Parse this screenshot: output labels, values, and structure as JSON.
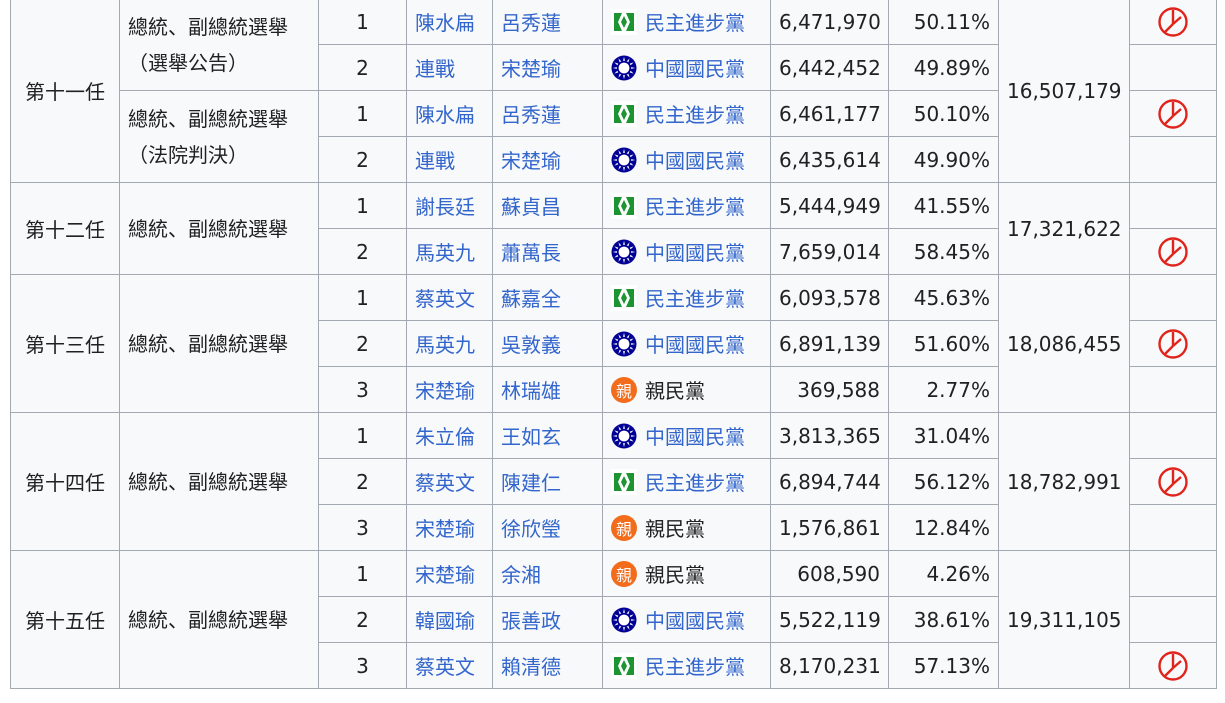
{
  "parties": {
    "dpp": {
      "name": "民主進步黨",
      "icon": "dpp-flag-icon",
      "color": "#1b9431"
    },
    "kmt": {
      "name": "中國國民黨",
      "icon": "kmt-sun-icon",
      "color": "#000095"
    },
    "pfp": {
      "name": "親民黨",
      "icon": "pfp-logo-icon",
      "color": "#f26c1b",
      "glyph": "親"
    }
  },
  "winner_mark": {
    "icon": "elected-stamp-icon",
    "color": "#e0241b"
  },
  "elections": [
    {
      "term": "第十一任",
      "total": "16,507,179",
      "subelections": [
        {
          "type": "總統、副總統選舉",
          "subtype": "（選舉公告）",
          "rows": [
            {
              "no": "1",
              "president": "陳水扁",
              "vice": "呂秀蓮",
              "party": "dpp",
              "votes": "6,471,970",
              "pct": "50.11%",
              "winner": true
            },
            {
              "no": "2",
              "president": "連戰",
              "vice": "宋楚瑜",
              "party": "kmt",
              "votes": "6,442,452",
              "pct": "49.89%",
              "winner": false
            }
          ]
        },
        {
          "type": "總統、副總統選舉",
          "subtype": "（法院判決）",
          "rows": [
            {
              "no": "1",
              "president": "陳水扁",
              "vice": "呂秀蓮",
              "party": "dpp",
              "votes": "6,461,177",
              "pct": "50.10%",
              "winner": true
            },
            {
              "no": "2",
              "president": "連戰",
              "vice": "宋楚瑜",
              "party": "kmt",
              "votes": "6,435,614",
              "pct": "49.90%",
              "winner": false
            }
          ]
        }
      ]
    },
    {
      "term": "第十二任",
      "total": "17,321,622",
      "subelections": [
        {
          "type": "總統、副總統選舉",
          "subtype": "",
          "rows": [
            {
              "no": "1",
              "president": "謝長廷",
              "vice": "蘇貞昌",
              "party": "dpp",
              "votes": "5,444,949",
              "pct": "41.55%",
              "winner": false
            },
            {
              "no": "2",
              "president": "馬英九",
              "vice": "蕭萬長",
              "party": "kmt",
              "votes": "7,659,014",
              "pct": "58.45%",
              "winner": true
            }
          ]
        }
      ]
    },
    {
      "term": "第十三任",
      "total": "18,086,455",
      "subelections": [
        {
          "type": "總統、副總統選舉",
          "subtype": "",
          "rows": [
            {
              "no": "1",
              "president": "蔡英文",
              "vice": "蘇嘉全",
              "party": "dpp",
              "votes": "6,093,578",
              "pct": "45.63%",
              "winner": false
            },
            {
              "no": "2",
              "president": "馬英九",
              "vice": "吳敦義",
              "party": "kmt",
              "votes": "6,891,139",
              "pct": "51.60%",
              "winner": true
            },
            {
              "no": "3",
              "president": "宋楚瑜",
              "vice": "林瑞雄",
              "party": "pfp",
              "votes": "369,588",
              "pct": "2.77%",
              "winner": false
            }
          ]
        }
      ]
    },
    {
      "term": "第十四任",
      "total": "18,782,991",
      "subelections": [
        {
          "type": "總統、副總統選舉",
          "subtype": "",
          "rows": [
            {
              "no": "1",
              "president": "朱立倫",
              "vice": "王如玄",
              "party": "kmt",
              "votes": "3,813,365",
              "pct": "31.04%",
              "winner": false
            },
            {
              "no": "2",
              "president": "蔡英文",
              "vice": "陳建仁",
              "party": "dpp",
              "votes": "6,894,744",
              "pct": "56.12%",
              "winner": true
            },
            {
              "no": "3",
              "president": "宋楚瑜",
              "vice": "徐欣瑩",
              "party": "pfp",
              "votes": "1,576,861",
              "pct": "12.84%",
              "winner": false
            }
          ]
        }
      ]
    },
    {
      "term": "第十五任",
      "total": "19,311,105",
      "subelections": [
        {
          "type": "總統、副總統選舉",
          "subtype": "",
          "rows": [
            {
              "no": "1",
              "president": "宋楚瑜",
              "vice": "余湘",
              "party": "pfp",
              "votes": "608,590",
              "pct": "4.26%",
              "winner": false
            },
            {
              "no": "2",
              "president": "韓國瑜",
              "vice": "張善政",
              "party": "kmt",
              "votes": "5,522,119",
              "pct": "38.61%",
              "winner": false
            },
            {
              "no": "3",
              "president": "蔡英文",
              "vice": "賴清德",
              "party": "dpp",
              "votes": "8,170,231",
              "pct": "57.13%",
              "winner": true
            }
          ]
        }
      ]
    }
  ]
}
